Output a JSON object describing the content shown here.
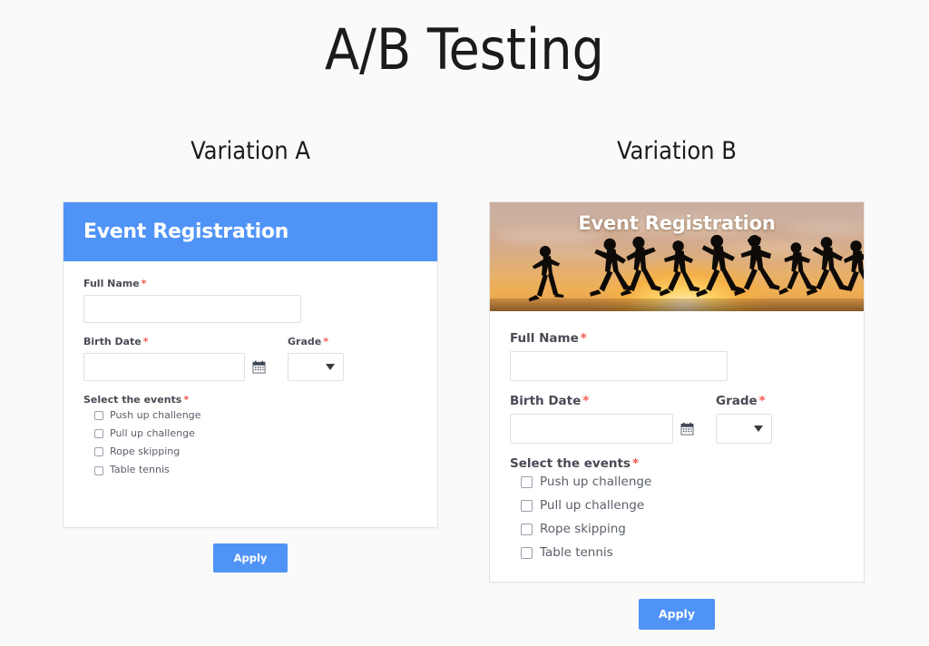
{
  "page": {
    "title": "A/B Testing",
    "background_color": "#fafafa"
  },
  "colors": {
    "accent_blue": "#4f93f7",
    "required_red": "#f4594e",
    "label_gray": "#4a4a55",
    "card_border": "#e4e4e6"
  },
  "variations": {
    "a": {
      "heading": "Variation A",
      "header": {
        "style": "solid-blue",
        "title": "Event Registration",
        "background_color": "#4f93f7"
      },
      "form": {
        "full_name": {
          "label": "Full Name",
          "required_mark": "*",
          "value": "",
          "placeholder": ""
        },
        "birth_date": {
          "label": "Birth Date",
          "required_mark": "*",
          "value": "",
          "placeholder": "",
          "icon": "calendar-icon"
        },
        "grade": {
          "label": "Grade",
          "required_mark": "*",
          "value": "",
          "icon": "chevron-down-icon"
        },
        "events": {
          "label": "Select the events",
          "required_mark": "*",
          "options": [
            {
              "label": "Push up challenge",
              "checked": false
            },
            {
              "label": "Pull up challenge",
              "checked": false
            },
            {
              "label": "Rope skipping",
              "checked": false
            },
            {
              "label": "Table tennis",
              "checked": false
            }
          ]
        }
      },
      "apply_label": "Apply"
    },
    "b": {
      "heading": "Variation B",
      "header": {
        "style": "photo-banner",
        "title": "Event Registration",
        "image_description": "runners silhouetted against a golden sunset sky"
      },
      "form": {
        "full_name": {
          "label": "Full Name",
          "required_mark": "*",
          "value": "",
          "placeholder": ""
        },
        "birth_date": {
          "label": "Birth Date",
          "required_mark": "*",
          "value": "",
          "placeholder": "",
          "icon": "calendar-icon"
        },
        "grade": {
          "label": "Grade",
          "required_mark": "*",
          "value": "",
          "icon": "chevron-down-icon"
        },
        "events": {
          "label": "Select the events",
          "required_mark": "*",
          "options": [
            {
              "label": "Push up challenge",
              "checked": false
            },
            {
              "label": "Pull up challenge",
              "checked": false
            },
            {
              "label": "Rope skipping",
              "checked": false
            },
            {
              "label": "Table tennis",
              "checked": false
            }
          ]
        }
      },
      "apply_label": "Apply"
    }
  }
}
